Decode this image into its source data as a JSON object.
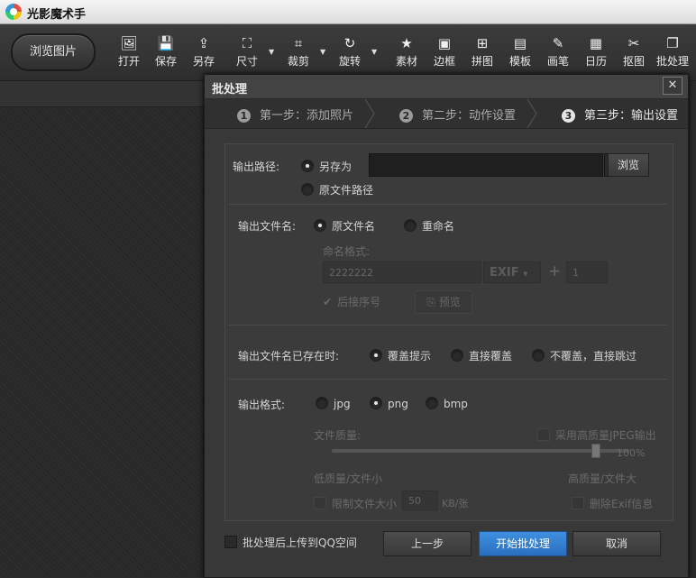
{
  "app": {
    "title": "光影魔术手"
  },
  "toolbar": {
    "browse_label": "浏览图片",
    "tools": [
      {
        "label": "打开",
        "icon": "open-image-icon"
      },
      {
        "label": "保存",
        "icon": "save-icon"
      },
      {
        "label": "另存",
        "icon": "save-as-icon"
      },
      {
        "label": "尺寸",
        "icon": "resize-icon"
      },
      {
        "label": "裁剪",
        "icon": "crop-icon"
      },
      {
        "label": "旋转",
        "icon": "rotate-icon"
      },
      {
        "label": "素材",
        "icon": "material-icon"
      },
      {
        "label": "边框",
        "icon": "border-icon"
      },
      {
        "label": "拼图",
        "icon": "collage-icon"
      },
      {
        "label": "模板",
        "icon": "template-icon"
      },
      {
        "label": "画笔",
        "icon": "brush-icon"
      },
      {
        "label": "日历",
        "icon": "calendar-icon"
      },
      {
        "label": "抠图",
        "icon": "cutout-icon"
      },
      {
        "label": "批处理",
        "icon": "batch-icon"
      }
    ]
  },
  "dialog": {
    "title": "批处理",
    "close": "✕",
    "steps": [
      {
        "num": "1",
        "label": "第一步：添加照片"
      },
      {
        "num": "2",
        "label": "第二步：动作设置"
      },
      {
        "num": "3",
        "label": "第三步：输出设置"
      }
    ],
    "output_path": {
      "label": "输出路径:",
      "option_save_as": "另存为",
      "option_original": "原文件路径",
      "path_value": "",
      "dropdown": "▼",
      "browse": "浏览"
    },
    "filename": {
      "label": "输出文件名:",
      "option_original": "原文件名",
      "option_rename": "重命名",
      "format_label": "命名格式:",
      "format_value": "2222222",
      "exif": "EXIF",
      "exif_caret": "▼",
      "plus": "+",
      "seq_value": "1",
      "suffix_seq": "后接序号",
      "preview": "预览"
    },
    "exists": {
      "label": "输出文件名已存在时:",
      "option_prompt": "覆盖提示",
      "option_overwrite": "直接覆盖",
      "option_skip": "不覆盖，直接跳过"
    },
    "format": {
      "label": "输出格式:",
      "jpg": "jpg",
      "png": "png",
      "bmp": "bmp",
      "quality_label": "文件质量:",
      "hq_jpeg": "采用高质量JPEG输出",
      "quality_percent": "100%",
      "quality_value": 100,
      "low": "低质量/文件小",
      "high": "高质量/文件大",
      "limit_size": "限制文件大小",
      "size_value": "50",
      "size_unit": "KB/张",
      "remove_exif": "删除Exif信息"
    },
    "upload_qq": "批处理后上传到QQ空间",
    "prev": "上一步",
    "start": "开始批处理",
    "cancel": "取消"
  }
}
